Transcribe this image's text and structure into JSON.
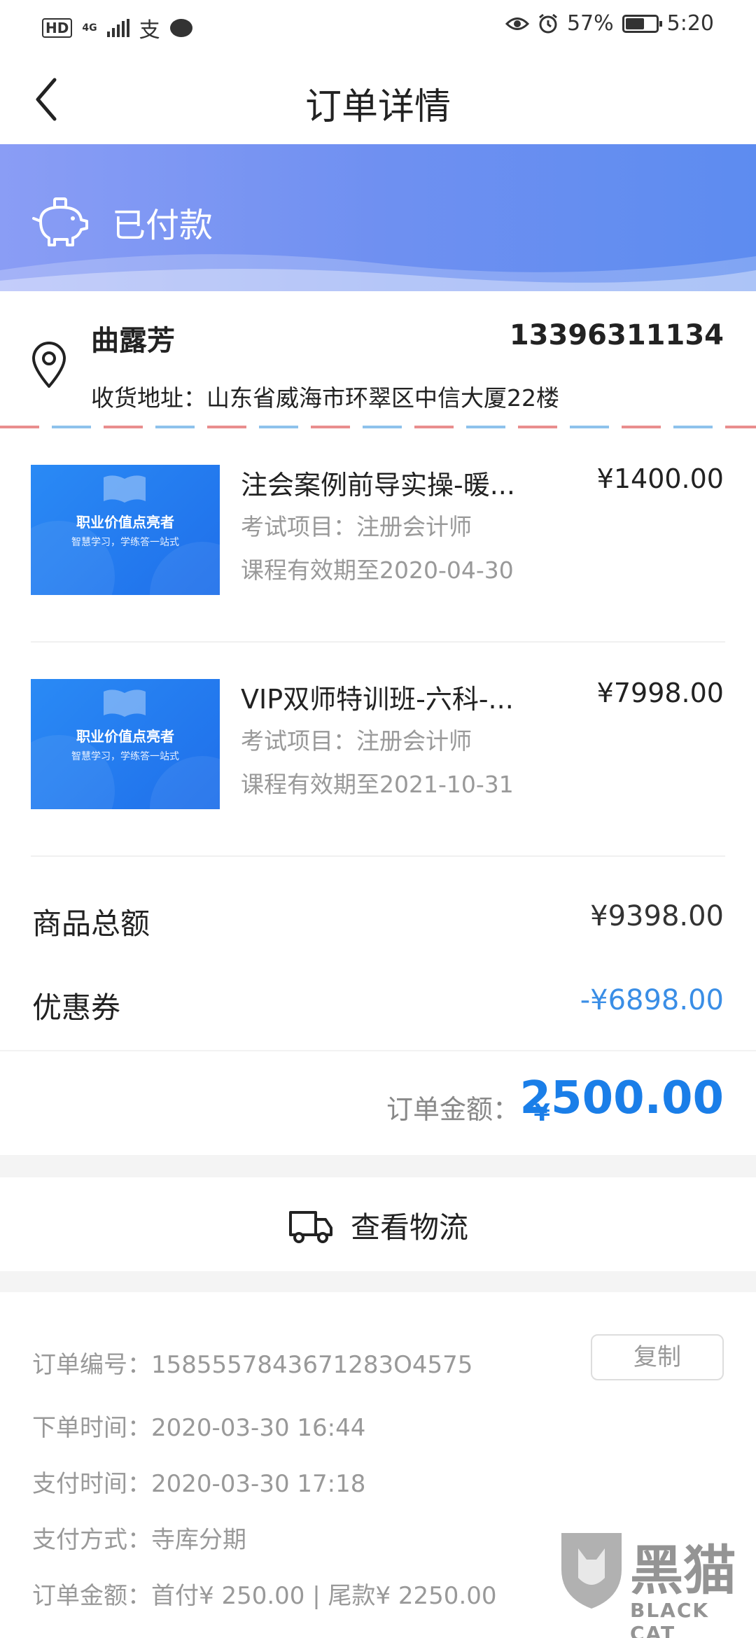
{
  "status_bar": {
    "hd": "HD",
    "network": "4G",
    "alipay_glyph": "支",
    "battery_percent": "57%",
    "time": "5:20",
    "icons": [
      "eye-icon",
      "alarm-icon",
      "battery-icon",
      "signal-icon",
      "chat-icon"
    ]
  },
  "nav": {
    "title": "订单详情",
    "back_icon": "chevron-left-icon"
  },
  "banner": {
    "status": "已付款",
    "icon": "piggy-bank-icon",
    "colors": {
      "start": "#8a9df5",
      "end": "#5d8cf0"
    }
  },
  "address": {
    "name": "曲露芳",
    "phone": "13396311134",
    "label": "收货地址：",
    "value": "山东省威海市环翠区中信大厦22楼",
    "icon": "location-pin-icon"
  },
  "products": [
    {
      "name": "注会案例前导实操-暖...",
      "price": "¥1400.00",
      "exam": "考试项目：注册会计师",
      "valid": "课程有效期至2020-04-30",
      "thumb_title": "职业价值点亮者",
      "thumb_subtitle": "智慧学习，学练答一站式"
    },
    {
      "name": "VIP双师特训班-六科-...",
      "price": "¥7998.00",
      "exam": "考试项目：注册会计师",
      "valid": "课程有效期至2021-10-31",
      "thumb_title": "职业价值点亮者",
      "thumb_subtitle": "智慧学习，学练答一站式"
    }
  ],
  "summary": {
    "goods_total_label": "商品总额",
    "goods_total_value": "¥9398.00",
    "coupon_label": "优惠券",
    "coupon_value": "-¥6898.00",
    "order_amount_label": "订单金额：",
    "order_currency": "¥",
    "order_amount_value": "2500.00"
  },
  "logistics": {
    "label": "查看物流",
    "icon": "truck-icon"
  },
  "order_info": {
    "number_label": "订单编号：",
    "number_value": "1585557843671283O4575",
    "copy_label": "复制",
    "created_label": "下单时间：",
    "created_value": "2020-03-30 16:44",
    "paid_label": "支付时间：",
    "paid_value": "2020-03-30 17:18",
    "method_label": "支付方式：",
    "method_value": "寺库分期",
    "amount_label": "订单金额：",
    "amount_value": "首付¥ 250.00 | 尾款¥ 2250.00"
  },
  "watermark": {
    "cn": "黑猫",
    "en": "BLACK CAT"
  },
  "colors": {
    "accent_blue": "#1a7ee8",
    "coupon_blue": "#3a8ee6",
    "muted_text": "#999999"
  }
}
